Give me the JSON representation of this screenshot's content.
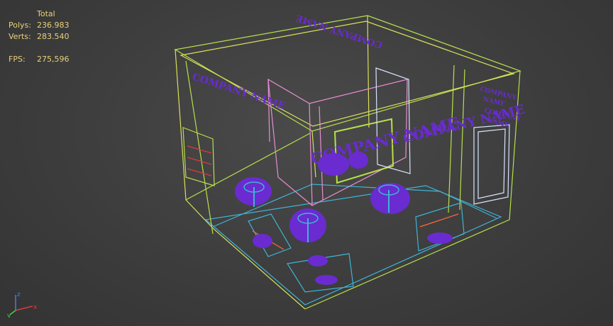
{
  "stats": {
    "header": "Total",
    "polys_label": "Polys:",
    "polys_value": "236.983",
    "verts_label": "Verts:",
    "verts_value": "283.540",
    "fps_label": "FPS:",
    "fps_value": "275,596"
  },
  "scene": {
    "mirrored_company_name": "COMPANY NAME",
    "wall_text_left": "COMPANY NAME",
    "back_text": "COMPANY NAME",
    "right_panel_text": [
      "COMPANY",
      "NAME",
      "COMPANY",
      "NAME"
    ]
  },
  "gizmo": {
    "x": "x",
    "y": "y",
    "z": "z"
  },
  "colors": {
    "background": "#3d3d3d",
    "stats_text": "#e8d27a",
    "wire_green": "#b7e04a",
    "wire_yellow": "#d9e05a",
    "wire_cyan": "#3fb3d6",
    "wire_pink": "#e88fd2",
    "wire_white": "#d8e4ff",
    "furniture_purple": "#6a2bd0",
    "accent_orange": "#ff6a3d",
    "accent_red": "#e03a3a"
  }
}
